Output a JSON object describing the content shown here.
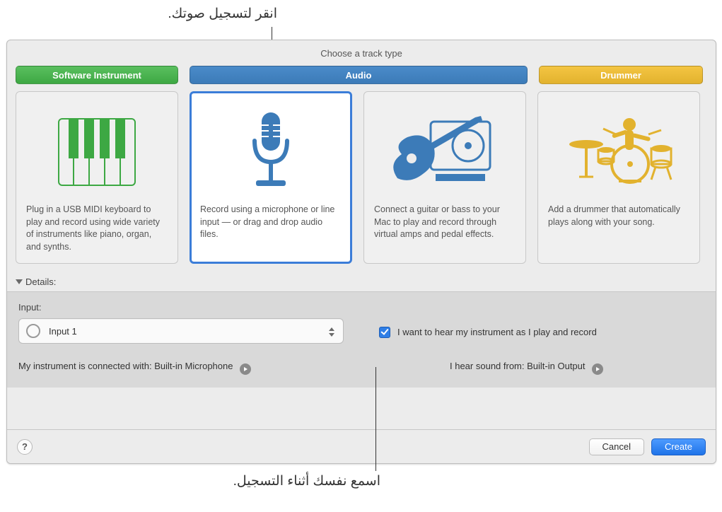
{
  "callouts": {
    "top": "انقر لتسجيل صوتك.",
    "bottom": "اسمع نفسك أثناء التسجيل."
  },
  "header": {
    "title": "Choose a track type"
  },
  "types": {
    "software": "Software Instrument",
    "audio": "Audio",
    "drummer": "Drummer"
  },
  "cards": [
    {
      "desc": "Plug in a USB MIDI keyboard to play and record using wide variety of instruments like piano, organ, and synths."
    },
    {
      "desc": "Record using a microphone or line input — or drag and drop audio files."
    },
    {
      "desc": "Connect a guitar or bass to your Mac to play and record through virtual amps and pedal effects."
    },
    {
      "desc": "Add a drummer that automatically plays along with your song."
    }
  ],
  "details": {
    "label": "Details:",
    "input_label": "Input:",
    "input_value": "Input 1",
    "monitor_label": "I want to hear my instrument as I play and record",
    "connection_prefix": "My instrument is connected with: ",
    "connection_value": "Built-in Microphone",
    "output_prefix": "I hear sound from: ",
    "output_value": "Built-in Output"
  },
  "footer": {
    "help": "?",
    "cancel": "Cancel",
    "create": "Create"
  }
}
